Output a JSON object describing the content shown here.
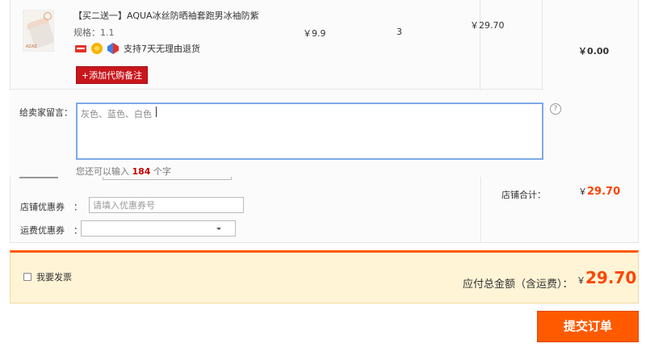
{
  "item": {
    "title": "【买二送一】AQUA冰丝防晒袖套跑男冰袖防紫",
    "sku": "规格：1.1",
    "thumb_tag": "AZAZ",
    "return_policy": "支持7天无理由退货",
    "unit_price": "￥9.9",
    "quantity": "3",
    "subtotal": "￥29.70",
    "shipping_fee": "￥0.00",
    "add_note_label": "+添加代购备注"
  },
  "message": {
    "label": "给卖家留言：",
    "value": "灰色、蓝色、白色",
    "hint_prefix": "您还可以输入",
    "hint_count": "184",
    "hint_suffix": "个字",
    "help_glyph": "?"
  },
  "coupons": {
    "store_coupon_label": "店铺优惠券　：",
    "store_coupon_placeholder": "请填入优惠券号",
    "shipping_coupon_label": "运费优惠券　：",
    "shipping_coupon_value": ""
  },
  "store_total": {
    "label": "店铺合计：",
    "currency": "￥",
    "amount": "29.70"
  },
  "summary": {
    "invoice_label": "我要发票",
    "payable_label": "应付总金额（含运费）：",
    "currency": "￥",
    "amount": "29.70"
  },
  "submit_label": "提交订单",
  "colors": {
    "accent": "#ff5a00",
    "price_red": "#ff4400",
    "note_button": "#c8161d",
    "summary_bg": "#fff4d6"
  }
}
